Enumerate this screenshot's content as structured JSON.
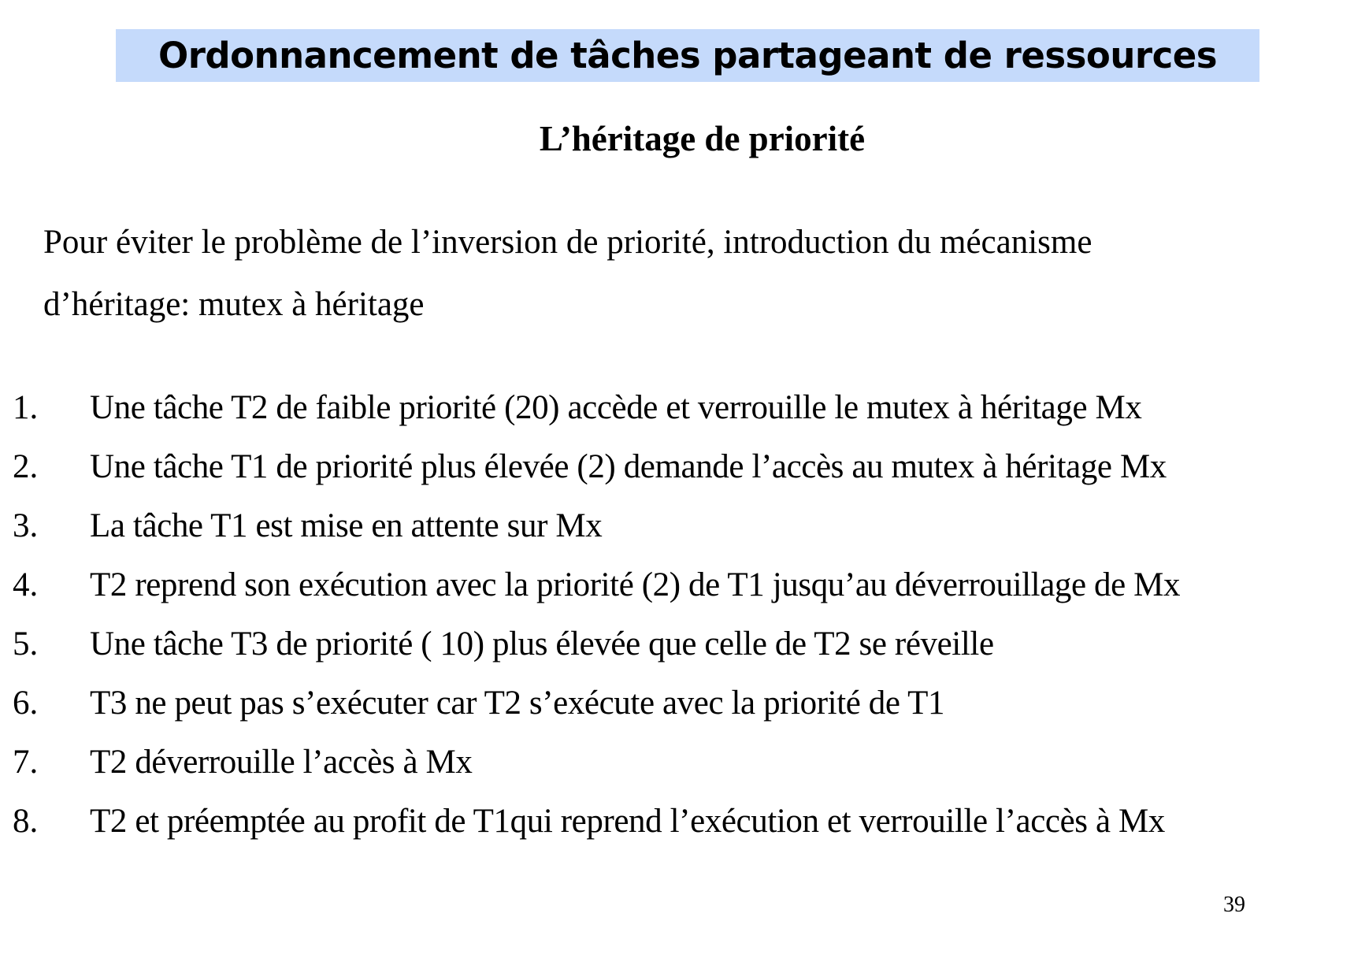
{
  "slide": {
    "title": "Ordonnancement de tâches partageant de ressources",
    "subtitle": "L’héritage de priorité",
    "intro_lines": [
      "Pour éviter le problème  de l’inversion de priorité, introduction du mécanisme",
      "d’héritage: mutex à héritage"
    ],
    "steps": [
      {
        "num": "1.",
        "text": "Une tâche T2 de faible priorité (20) accède et verrouille le mutex à héritage Mx"
      },
      {
        "num": "2.",
        "text": "Une tâche T1 de priorité plus élevée (2) demande l’accès au mutex à héritage Mx"
      },
      {
        "num": "3.",
        "text": "La tâche T1 est mise en attente sur Mx"
      },
      {
        "num": "4.",
        "text": "T2 reprend son exécution avec la priorité (2) de T1 jusqu’au déverrouillage de Mx"
      },
      {
        "num": "5.",
        "text": "Une tâche T3 de priorité ( 10) plus élevée que celle de T2 se réveille"
      },
      {
        "num": "6.",
        "text": "T3 ne peut pas s’exécuter car T2 s’exécute avec la priorité de T1"
      },
      {
        "num": "7.",
        "text": "T2 déverrouille l’accès à Mx"
      },
      {
        "num": "8.",
        "text": "T2 et préemptée au profit de T1qui reprend l’exécution et verrouille l’accès à Mx"
      }
    ],
    "page_number": "39",
    "title_bar_color": "#c5dafb"
  }
}
